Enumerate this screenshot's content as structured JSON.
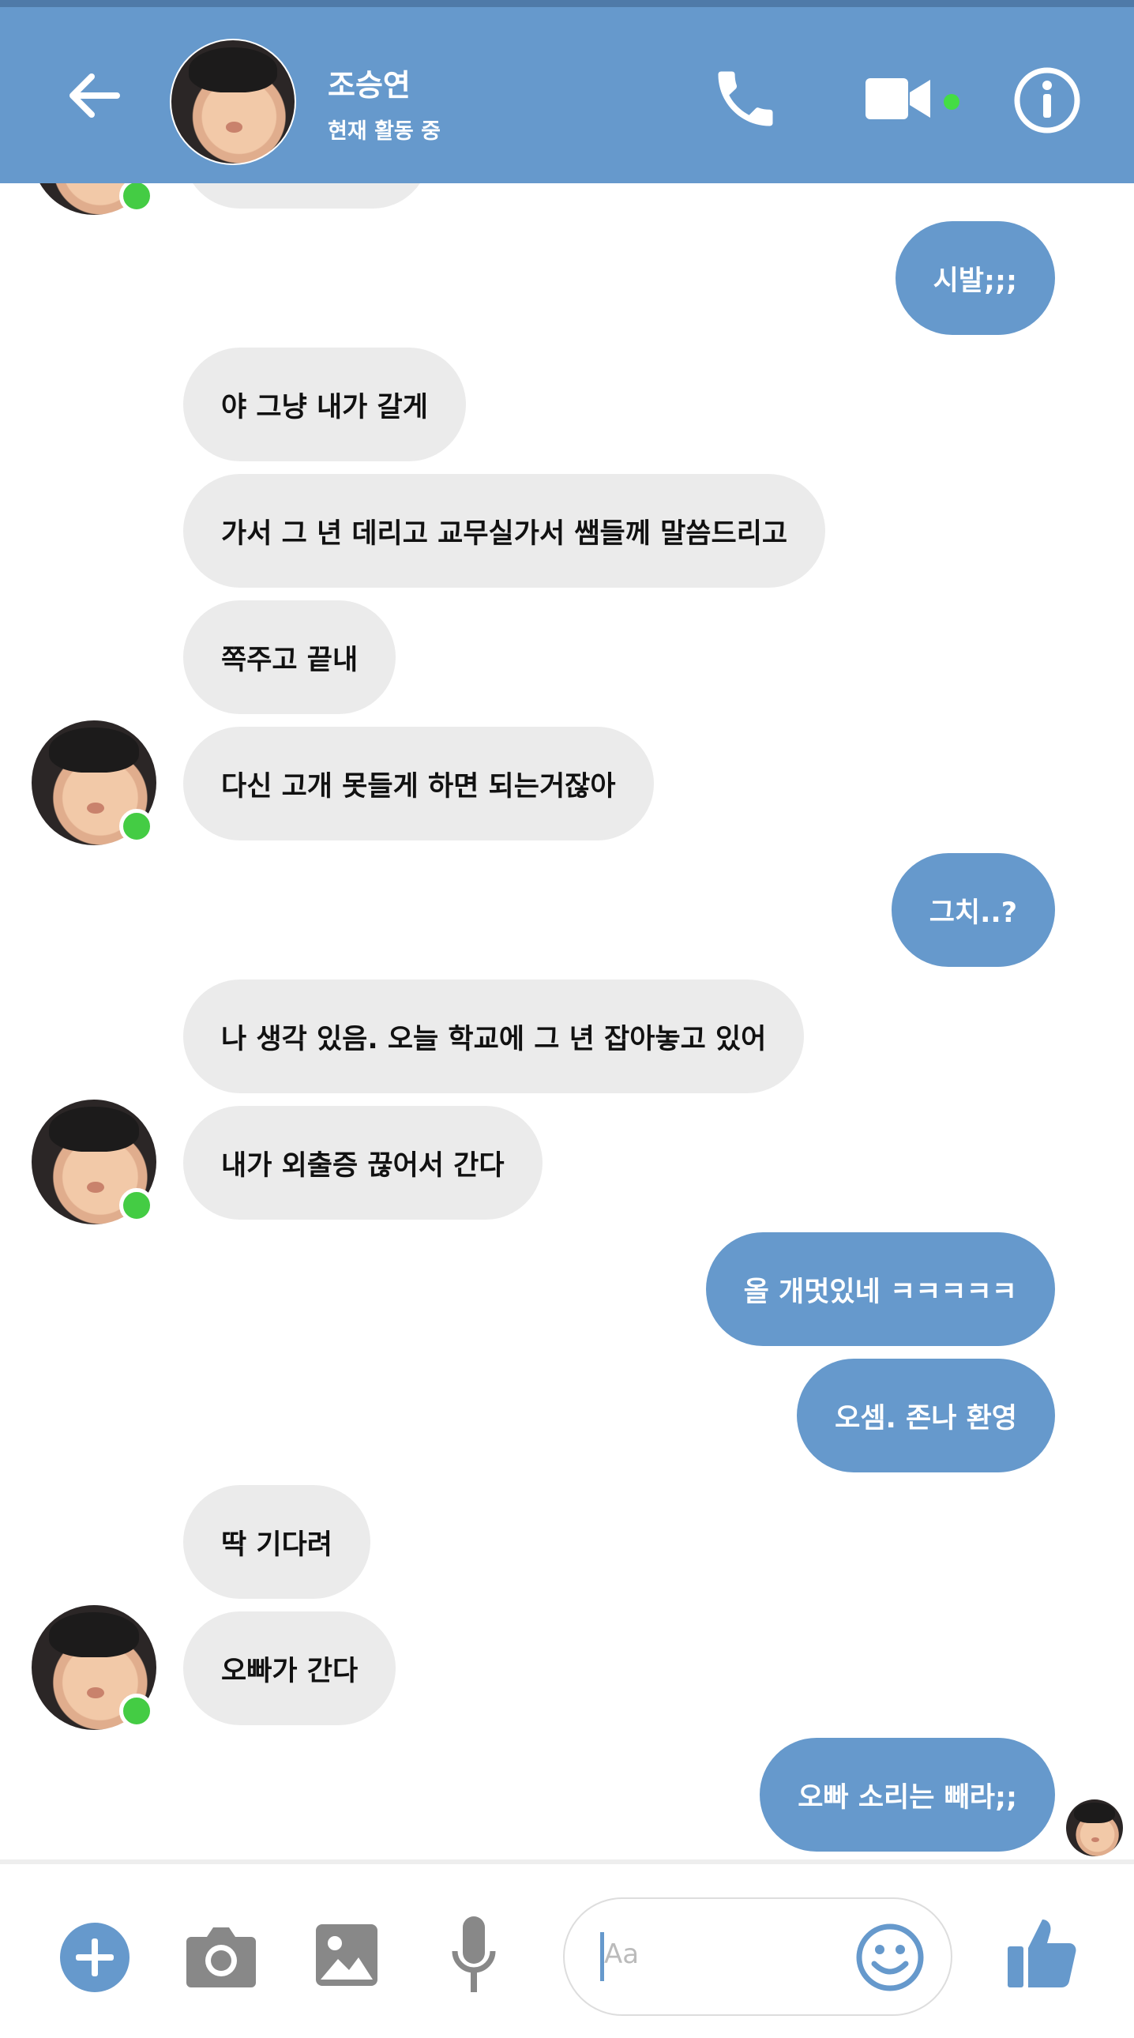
{
  "header": {
    "contact_name": "조승연",
    "status": "현재 활동 중",
    "icons": [
      "back-arrow-icon",
      "phone-icon",
      "video-camera-icon",
      "info-icon"
    ],
    "accent_color": "#6699cc",
    "online_color": "#44cc44"
  },
  "messages": [
    {
      "dir": "out",
      "text": "시발;;;"
    },
    {
      "dir": "in",
      "text": "야 그냥 내가 갈게"
    },
    {
      "dir": "in",
      "text": "가서 그 년 데리고 교무실가서 쌤들께 말씀드리고"
    },
    {
      "dir": "in",
      "text": "쪽주고 끝내"
    },
    {
      "dir": "in",
      "text": "다신 고개 못들게 하면 되는거잖아"
    },
    {
      "dir": "out",
      "text": "그치..?"
    },
    {
      "dir": "in",
      "text": "나 생각 있음. 오늘 학교에 그 년 잡아놓고 있어"
    },
    {
      "dir": "in",
      "text": "내가 외출증 끊어서 간다"
    },
    {
      "dir": "out",
      "text": "올 개멋있네 ㅋㅋㅋㅋㅋ"
    },
    {
      "dir": "out",
      "text": "오셈. 존나 환영"
    },
    {
      "dir": "in",
      "text": "딱 기다려"
    },
    {
      "dir": "in",
      "text": "오빠가 간다"
    },
    {
      "dir": "out",
      "text": "오빠 소리는 빼라;;"
    }
  ],
  "composer": {
    "placeholder": "Aa",
    "icons": [
      "plus-icon",
      "camera-icon",
      "image-icon",
      "microphone-icon",
      "emoji-icon",
      "thumbs-up-icon"
    ]
  }
}
